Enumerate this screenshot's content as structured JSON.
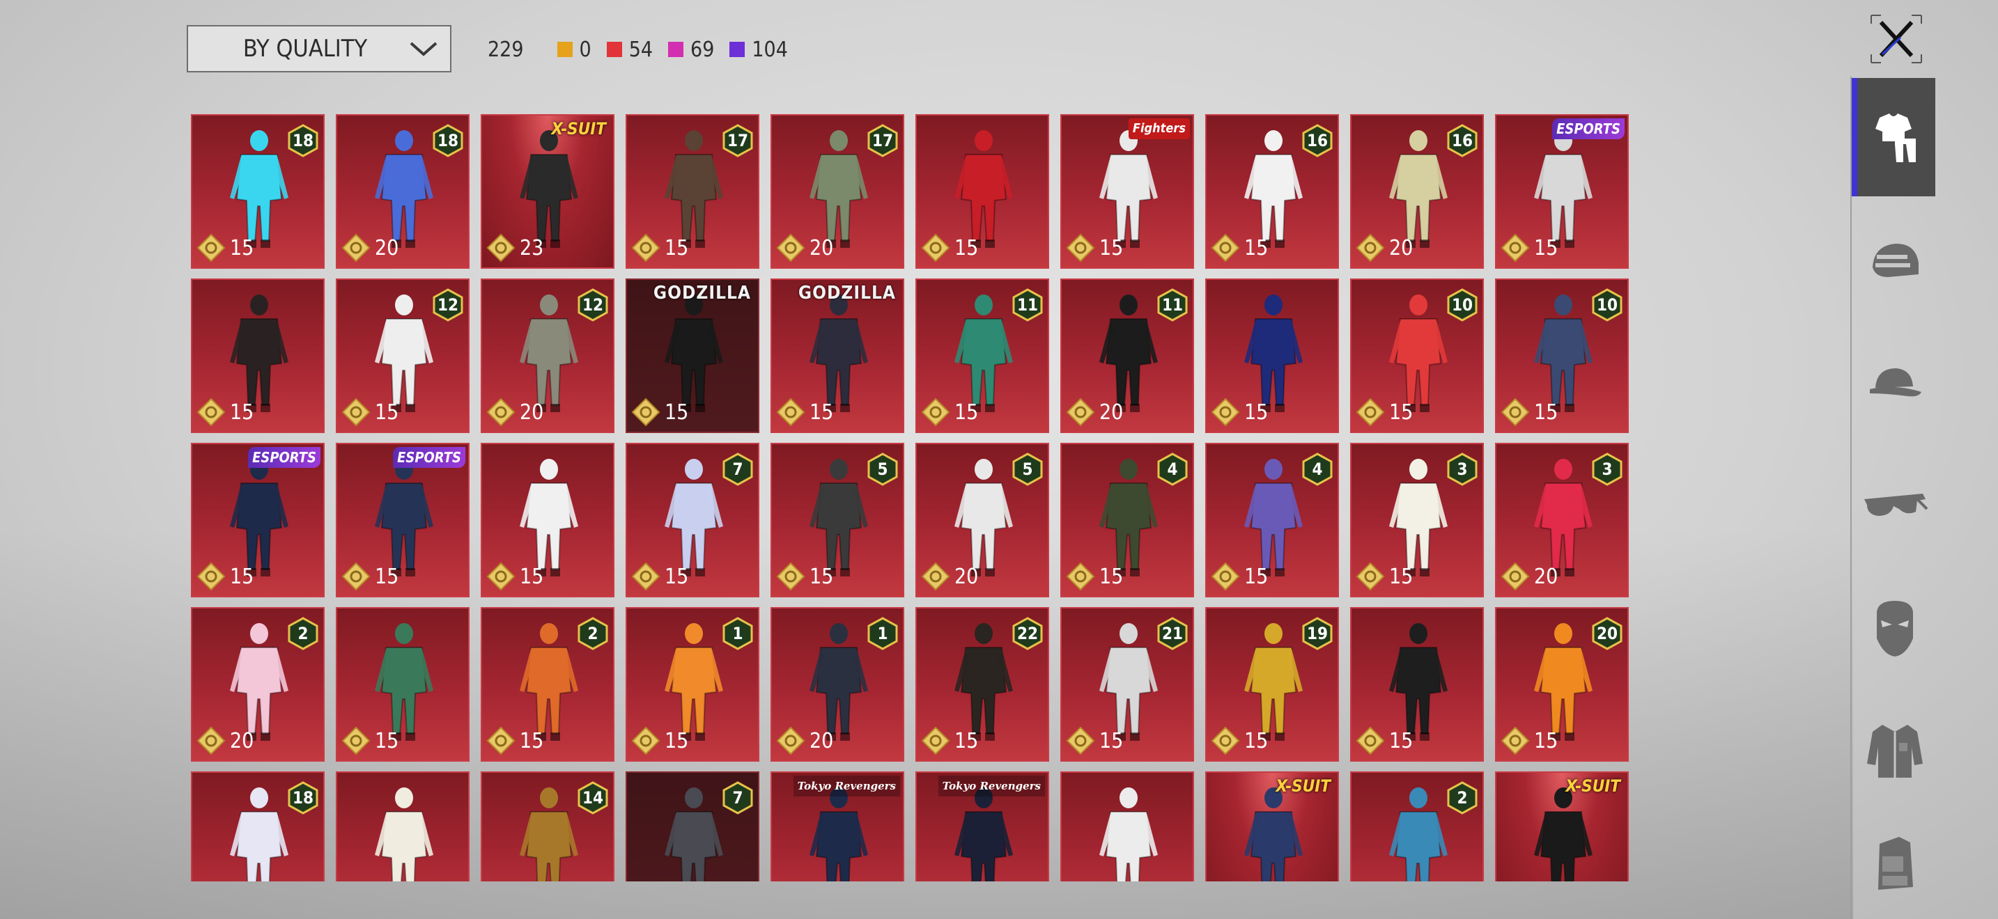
{
  "sort": {
    "label": "BY QUALITY"
  },
  "counts": {
    "total": "229",
    "qualities": [
      {
        "value": "0",
        "color": "#e5a21a"
      },
      {
        "value": "54",
        "color": "#e13338"
      },
      {
        "value": "69",
        "color": "#d32fb1"
      },
      {
        "value": "104",
        "color": "#6d2fd8"
      }
    ]
  },
  "sidebar": {
    "categories": [
      {
        "name": "outfit",
        "active": true
      },
      {
        "name": "helmet",
        "active": false
      },
      {
        "name": "cap",
        "active": false
      },
      {
        "name": "glasses",
        "active": false
      },
      {
        "name": "mask",
        "active": false
      },
      {
        "name": "jacket",
        "active": false
      },
      {
        "name": "backpack",
        "active": false
      }
    ]
  },
  "items": [
    {
      "level": "18",
      "cost": "15",
      "tag": "",
      "figure": "#3ad6f0",
      "style": ""
    },
    {
      "level": "18",
      "cost": "20",
      "tag": "",
      "figure": "#4a6cd8",
      "style": ""
    },
    {
      "level": "",
      "cost": "23",
      "tag": "X-SUIT",
      "tagStyle": "xsuit",
      "figure": "#2a2a2a",
      "style": "spot"
    },
    {
      "level": "17",
      "cost": "15",
      "tag": "",
      "figure": "#5a4334",
      "style": ""
    },
    {
      "level": "17",
      "cost": "20",
      "tag": "",
      "figure": "#7a8a6a",
      "style": ""
    },
    {
      "level": "",
      "cost": "15",
      "tag": "",
      "figure": "#c81e28",
      "style": ""
    },
    {
      "level": "",
      "cost": "15",
      "tag": "Fighters",
      "tagStyle": "kof",
      "figure": "#e9e9e9",
      "style": ""
    },
    {
      "level": "16",
      "cost": "15",
      "tag": "",
      "figure": "#f1f1f1",
      "style": ""
    },
    {
      "level": "16",
      "cost": "20",
      "tag": "",
      "figure": "#d6cfa0",
      "style": ""
    },
    {
      "level": "",
      "cost": "15",
      "tag": "ESPORTS",
      "tagStyle": "esports",
      "figure": "#d8d8d8",
      "style": ""
    },
    {
      "level": "",
      "cost": "15",
      "tag": "",
      "figure": "#2a2222",
      "style": ""
    },
    {
      "level": "12",
      "cost": "15",
      "tag": "",
      "figure": "#eeeeee",
      "style": ""
    },
    {
      "level": "12",
      "cost": "20",
      "tag": "",
      "figure": "#8a8a7a",
      "style": ""
    },
    {
      "level": "",
      "cost": "15",
      "tag": "GODZILLA",
      "tagStyle": "godzilla",
      "figure": "#1a1a1a",
      "style": "dark"
    },
    {
      "level": "",
      "cost": "15",
      "tag": "GODZILLA",
      "tagStyle": "godzilla",
      "figure": "#2c2c3c",
      "style": ""
    },
    {
      "level": "11",
      "cost": "15",
      "tag": "",
      "figure": "#2e8a72",
      "style": ""
    },
    {
      "level": "11",
      "cost": "20",
      "tag": "",
      "figure": "#1c1c1c",
      "style": ""
    },
    {
      "level": "",
      "cost": "15",
      "tag": "",
      "figure": "#1e2a7a",
      "style": ""
    },
    {
      "level": "10",
      "cost": "15",
      "tag": "",
      "figure": "#e23a3a",
      "style": ""
    },
    {
      "level": "10",
      "cost": "15",
      "tag": "",
      "figure": "#3a4a72",
      "style": ""
    },
    {
      "level": "",
      "cost": "15",
      "tag": "ESPORTS",
      "tagStyle": "esports",
      "figure": "#1e2a4a",
      "style": ""
    },
    {
      "level": "",
      "cost": "15",
      "tag": "ESPORTS",
      "tagStyle": "esports",
      "figure": "#253456",
      "style": ""
    },
    {
      "level": "",
      "cost": "15",
      "tag": "",
      "figure": "#f0f0f0",
      "style": ""
    },
    {
      "level": "7",
      "cost": "15",
      "tag": "",
      "figure": "#c9d0ef",
      "style": ""
    },
    {
      "level": "5",
      "cost": "15",
      "tag": "",
      "figure": "#3a3a3a",
      "style": ""
    },
    {
      "level": "5",
      "cost": "20",
      "tag": "",
      "figure": "#e8e8e8",
      "style": ""
    },
    {
      "level": "4",
      "cost": "15",
      "tag": "",
      "figure": "#3e4a30",
      "style": ""
    },
    {
      "level": "4",
      "cost": "15",
      "tag": "",
      "figure": "#6a5ab8",
      "style": ""
    },
    {
      "level": "3",
      "cost": "15",
      "tag": "",
      "figure": "#f3f1e6",
      "style": ""
    },
    {
      "level": "3",
      "cost": "20",
      "tag": "",
      "figure": "#e22a4a",
      "style": ""
    },
    {
      "level": "2",
      "cost": "20",
      "tag": "",
      "figure": "#f3c6d8",
      "style": ""
    },
    {
      "level": "",
      "cost": "15",
      "tag": "",
      "figure": "#3a7a5a",
      "style": ""
    },
    {
      "level": "2",
      "cost": "15",
      "tag": "",
      "figure": "#e06a2a",
      "style": ""
    },
    {
      "level": "1",
      "cost": "15",
      "tag": "",
      "figure": "#f08a2a",
      "style": ""
    },
    {
      "level": "1",
      "cost": "20",
      "tag": "",
      "figure": "#2a3040",
      "style": ""
    },
    {
      "level": "22",
      "cost": "15",
      "tag": "",
      "figure": "#2a2520",
      "style": ""
    },
    {
      "level": "21",
      "cost": "15",
      "tag": "",
      "figure": "#d8d8d8",
      "style": ""
    },
    {
      "level": "19",
      "cost": "15",
      "tag": "",
      "figure": "#d6a82a",
      "style": ""
    },
    {
      "level": "",
      "cost": "15",
      "tag": "",
      "figure": "#1e1e1e",
      "style": ""
    },
    {
      "level": "20",
      "cost": "15",
      "tag": "",
      "figure": "#f08a20",
      "style": ""
    },
    {
      "level": "18",
      "cost": "",
      "tag": "",
      "figure": "#e6e6f4",
      "style": ""
    },
    {
      "level": "",
      "cost": "",
      "tag": "",
      "figure": "#f0ece0",
      "style": ""
    },
    {
      "level": "14",
      "cost": "",
      "tag": "",
      "figure": "#a8782a",
      "style": ""
    },
    {
      "level": "7",
      "cost": "",
      "tag": "",
      "figure": "#4a4a52",
      "style": "dark"
    },
    {
      "level": "",
      "cost": "",
      "tag": "Tokyo Revengers",
      "tagStyle": "tb",
      "figure": "#1e2a4a",
      "style": ""
    },
    {
      "level": "",
      "cost": "",
      "tag": "Tokyo Revengers",
      "tagStyle": "tb",
      "figure": "#1c2036",
      "style": ""
    },
    {
      "level": "",
      "cost": "",
      "tag": "",
      "figure": "#ececec",
      "style": ""
    },
    {
      "level": "",
      "cost": "",
      "tag": "X-SUIT",
      "tagStyle": "xsuit",
      "figure": "#2a3a6a",
      "style": "spot"
    },
    {
      "level": "2",
      "cost": "",
      "tag": "",
      "figure": "#3a8ab8",
      "style": ""
    },
    {
      "level": "",
      "cost": "",
      "tag": "X-SUIT",
      "tagStyle": "xsuit",
      "figure": "#1a1a1a",
      "style": "spot"
    }
  ]
}
